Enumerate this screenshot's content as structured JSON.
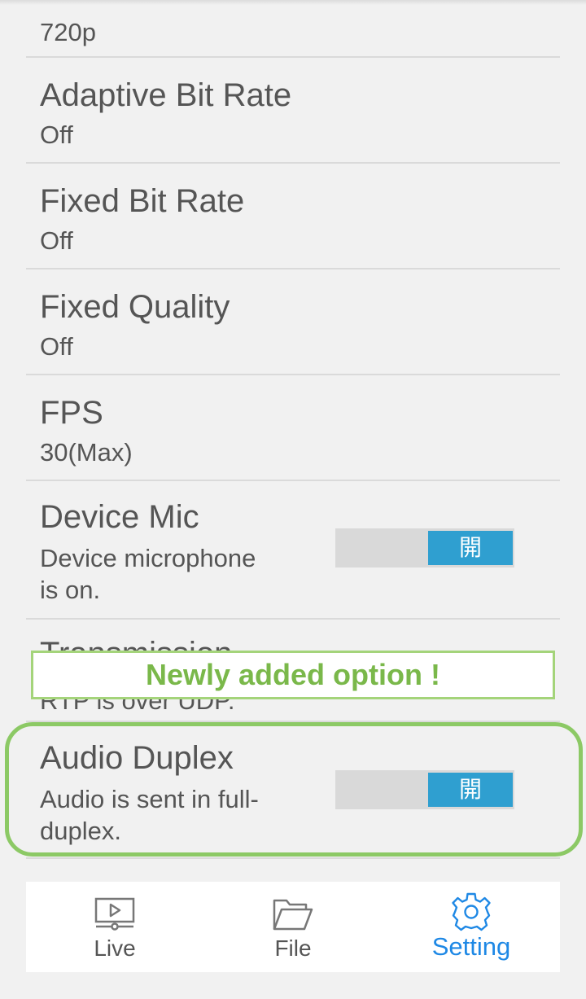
{
  "settings": [
    {
      "title": "",
      "value": "720p"
    },
    {
      "title": "Adaptive Bit Rate",
      "value": "Off"
    },
    {
      "title": "Fixed Bit Rate",
      "value": "Off"
    },
    {
      "title": "Fixed Quality",
      "value": "Off"
    },
    {
      "title": "FPS",
      "value": "30(Max)"
    },
    {
      "title": "Device Mic",
      "desc_line1": "Device microphone",
      "desc_line2": "is on.",
      "toggle_label": "開",
      "toggle_on": true
    },
    {
      "title": "Transmission",
      "value": "RTP is over UDP."
    },
    {
      "title": "Audio Duplex",
      "desc_line1": "Audio is sent in full-",
      "desc_line2": "duplex.",
      "toggle_label": "開",
      "toggle_on": true
    }
  ],
  "callout": "Newly added option !",
  "tabs": [
    {
      "label": "Live",
      "icon": "live-video-icon",
      "active": false
    },
    {
      "label": "File",
      "icon": "folder-icon",
      "active": false
    },
    {
      "label": "Setting",
      "icon": "gear-icon",
      "active": true
    }
  ],
  "colors": {
    "accent": "#2f9fd0",
    "active_tab": "#1e88e5",
    "highlight": "#8cc965",
    "callout_text": "#7ab84a"
  }
}
